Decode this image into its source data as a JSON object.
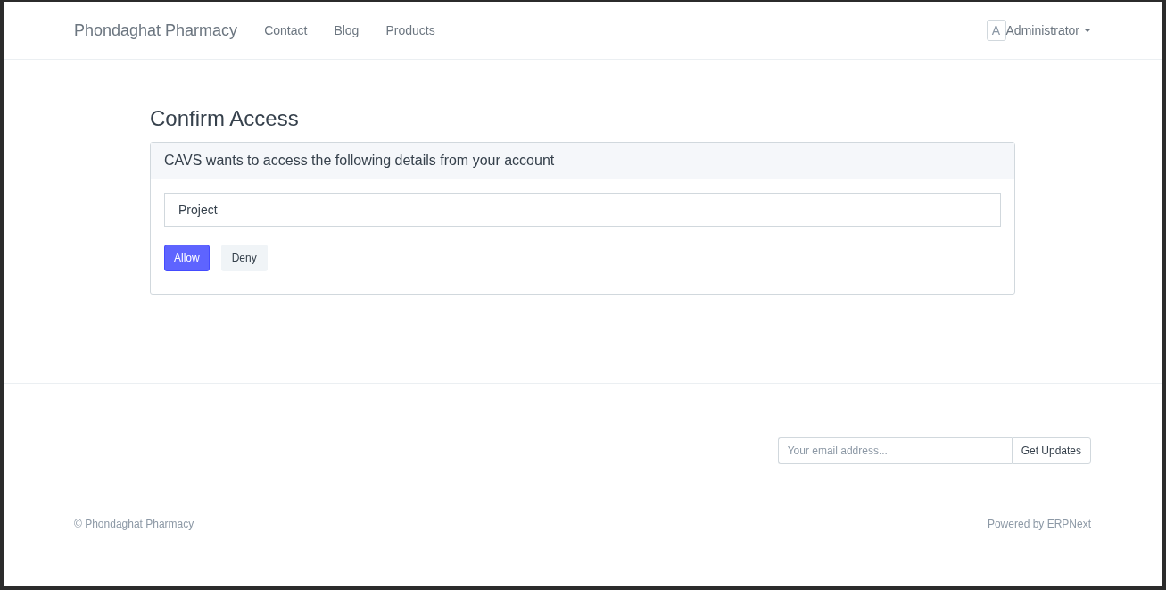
{
  "navbar": {
    "brand": "Phondaghat Pharmacy",
    "links": [
      {
        "label": "Contact"
      },
      {
        "label": "Blog"
      },
      {
        "label": "Products"
      }
    ],
    "user": {
      "avatar_letter": "A",
      "name": "Administrator"
    }
  },
  "page": {
    "title": "Confirm Access",
    "card": {
      "header": "CAVS wants to access the following details from your account",
      "scopes": [
        "Project"
      ],
      "buttons": [
        {
          "label": "Allow",
          "kind": "primary"
        },
        {
          "label": "Deny",
          "kind": "secondary"
        }
      ]
    }
  },
  "footer": {
    "subscribe": {
      "placeholder": "Your email address...",
      "button": "Get Updates"
    },
    "copyright": "© Phondaghat Pharmacy",
    "powered_by": "Powered by ERPNext"
  }
}
